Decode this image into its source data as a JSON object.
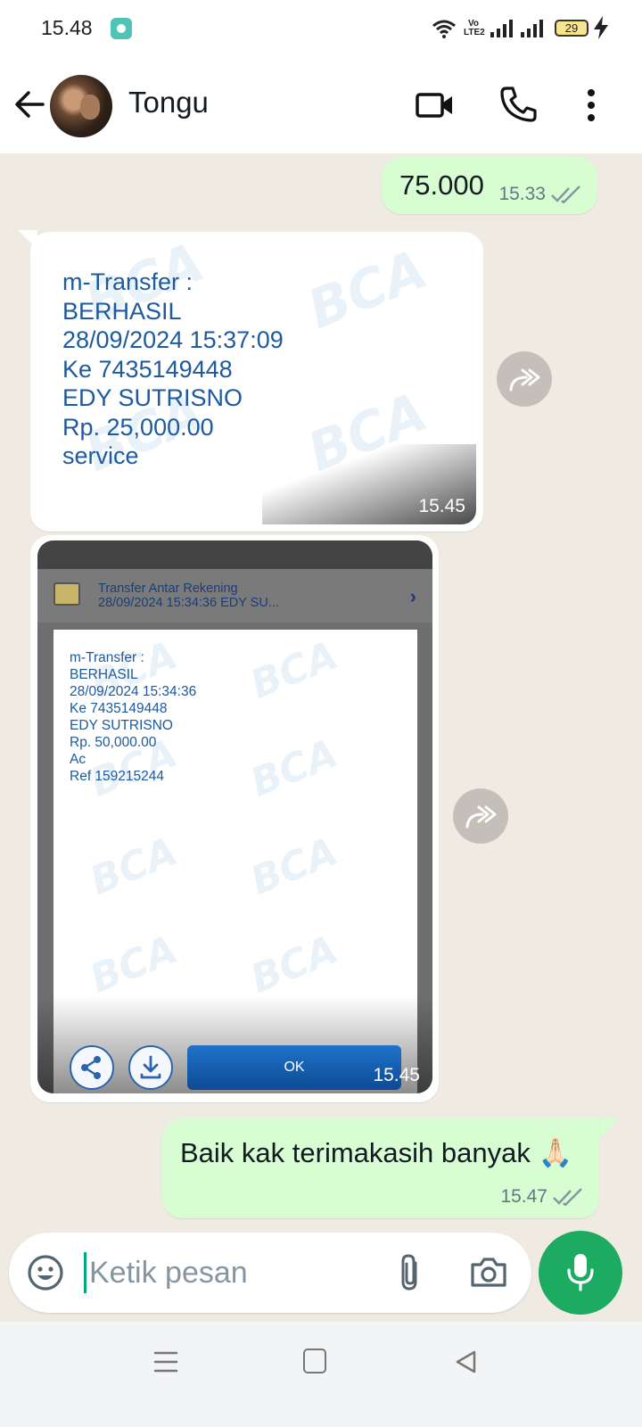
{
  "status_bar": {
    "time": "15.48",
    "network_label": "Vo LTE2",
    "battery": "29"
  },
  "header": {
    "contact_name": "Tongu"
  },
  "messages": [
    {
      "direction": "outgoing",
      "type": "text",
      "text": "75.000",
      "time": "15.33",
      "status": "read"
    },
    {
      "direction": "incoming",
      "type": "image",
      "time": "15.45",
      "image": {
        "watermark": "BCA",
        "lines": [
          "m-Transfer :",
          "BERHASIL",
          "28/09/2024 15:37:09",
          "Ke 7435149448",
          "EDY SUTRISNO",
          "Rp. 25,000.00",
          "service"
        ]
      }
    },
    {
      "direction": "incoming",
      "type": "image",
      "time": "15.45",
      "image": {
        "watermark": "BCA",
        "row_title": "Transfer Antar Rekening",
        "row_subtitle": "28/09/2024 15:34:36 EDY SU...",
        "lines": [
          "m-Transfer :",
          "BERHASIL",
          "28/09/2024 15:34:36",
          "Ke 7435149448",
          "EDY SUTRISNO",
          "Rp. 50,000.00",
          "Ac",
          "Ref 159215244"
        ],
        "ok_label": "OK"
      }
    },
    {
      "direction": "outgoing",
      "type": "text",
      "text": "Baik kak terimakasih banyak 🙏🏻",
      "time": "15.47",
      "status": "read"
    }
  ],
  "composer": {
    "placeholder": "Ketik pesan"
  },
  "colors": {
    "outgoing_bubble": "#d9fdd3",
    "incoming_bubble": "#ffffff",
    "chat_background": "#efeae2",
    "accent_green": "#1daa61",
    "read_tick": "#667781"
  },
  "icons": {
    "header": [
      "arrow-left-icon",
      "video-camera-icon",
      "phone-icon",
      "more-vertical-icon"
    ],
    "composer": [
      "emoji-icon",
      "paperclip-icon",
      "camera-icon",
      "microphone-icon"
    ],
    "forward": "forward-icon",
    "navigation": [
      "menu-lines-icon",
      "home-square-icon",
      "back-triangle-icon"
    ]
  }
}
